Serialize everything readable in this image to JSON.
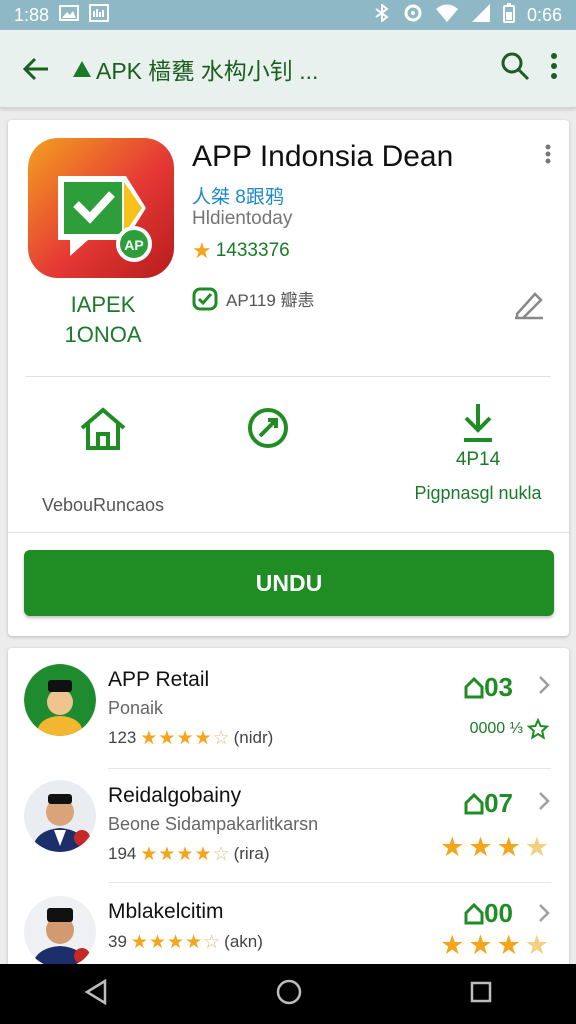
{
  "status_bar": {
    "time": "1:88",
    "battery_time": "0:66"
  },
  "toolbar": {
    "title": "APK 樯甕 水构小钊 ...",
    "back": "back-arrow-icon",
    "search": "search-icon",
    "more": "more-vert-icon"
  },
  "app": {
    "title": "APP Indonsia Dean",
    "developer": "人桀 8跟鸦",
    "subtitle": "Hldientoday",
    "rating": "1433376",
    "dev_tag_line1": "IAPEK",
    "dev_tag_line2": "1ONOA",
    "verified_text": "AP119 瓣恚",
    "stats": [
      {
        "label": "VebouRuncaos",
        "icon": "home-icon"
      },
      {
        "label": "",
        "icon": "share-icon"
      },
      {
        "value": "4P14",
        "label": "Pigpnasgl nukla",
        "icon": "download-icon"
      }
    ],
    "install_label": "UNDU"
  },
  "list": [
    {
      "title": "APP Retail",
      "subtitle": "Ponaik",
      "meta_num": "123",
      "meta_tail": "(nidr)",
      "badge": "03",
      "right_text": "0000 ⅓",
      "stars": 4
    },
    {
      "title": "Reidalgobainy",
      "subtitle": "Beone Sidampakarlitkarsn",
      "meta_num": "194",
      "meta_tail": "(rira)",
      "badge": "07",
      "stars": 4
    },
    {
      "title": "Mblakelcitim",
      "subtitle": "",
      "meta_num": "39",
      "meta_tail": "(akn)",
      "badge": "00",
      "stars": 4
    }
  ],
  "colors": {
    "accent": "#1f8c24",
    "status_bar": "#8fb8c6",
    "toolbar": "#e9f1ee",
    "link": "#1e88c8",
    "star": "#f4a51c"
  }
}
